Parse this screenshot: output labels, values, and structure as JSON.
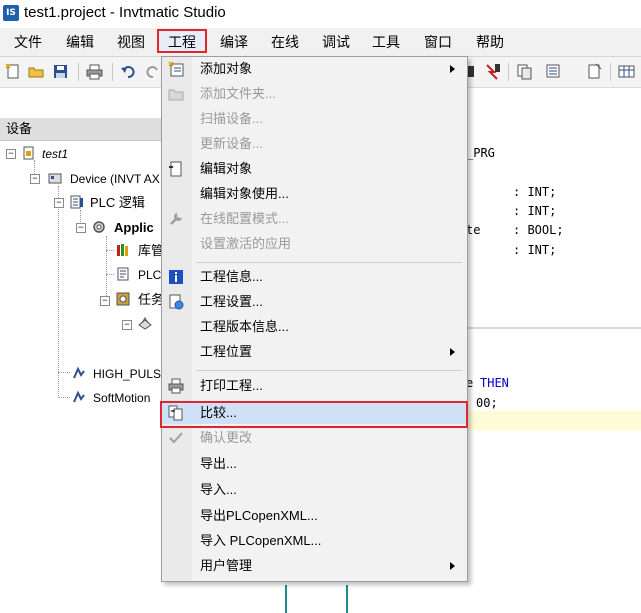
{
  "window": {
    "title": "test1.project - Invtmatic Studio",
    "logo": "IS"
  },
  "menubar": {
    "items": [
      "文件",
      "编辑",
      "视图",
      "工程",
      "编译",
      "在线",
      "调试",
      "工具",
      "窗口",
      "帮助"
    ],
    "active": "工程"
  },
  "device_pane": {
    "header": "设备",
    "tree": {
      "project": "test1",
      "device": "Device (INVT AX",
      "plc_logic": "PLC 逻辑",
      "application": "Applic",
      "library": "库管",
      "plc_prg": "PLC",
      "task": "任务",
      "high_puls": "HIGH_PULS",
      "softmotion": "SoftMotion"
    }
  },
  "editor": {
    "header_fragment": "_PRG",
    "decl_lines": [
      {
        "name": "",
        "type": ": INT;"
      },
      {
        "name": "",
        "type": ": INT;"
      },
      {
        "name": "te",
        "type": ": BOOL;"
      },
      {
        "name": "",
        "type": ": INT;"
      }
    ],
    "code_line1_prefix": "e",
    "code_line1_keyword": "THEN",
    "code_line2": "00;"
  },
  "dropdown": {
    "items": [
      {
        "label": "添加对象",
        "disabled": false,
        "submenu": true,
        "icon": "add-object-icon"
      },
      {
        "label": "添加文件夹...",
        "disabled": true,
        "submenu": false,
        "icon": "folder-icon"
      },
      {
        "label": "扫描设备...",
        "disabled": true,
        "submenu": false,
        "icon": ""
      },
      {
        "label": "更新设备...",
        "disabled": true,
        "submenu": false,
        "icon": ""
      },
      {
        "label": "编辑对象",
        "disabled": false,
        "submenu": false,
        "icon": "edit-object-icon"
      },
      {
        "label": "编辑对象使用...",
        "disabled": false,
        "submenu": false,
        "icon": ""
      },
      {
        "label": "在线配置模式...",
        "disabled": true,
        "submenu": false,
        "icon": "wrench-icon"
      },
      {
        "label": "设置激活的应用",
        "disabled": true,
        "submenu": false,
        "icon": ""
      },
      {
        "label": "工程信息...",
        "disabled": false,
        "submenu": false,
        "icon": "info-icon"
      },
      {
        "label": "工程设置...",
        "disabled": false,
        "submenu": false,
        "icon": "settings-icon"
      },
      {
        "label": "工程版本信息...",
        "disabled": false,
        "submenu": false,
        "icon": ""
      },
      {
        "label": "工程位置",
        "disabled": false,
        "submenu": true,
        "icon": ""
      },
      {
        "label": "打印工程...",
        "disabled": false,
        "submenu": false,
        "icon": "print-icon"
      },
      {
        "label": "比较...",
        "disabled": false,
        "submenu": false,
        "icon": "compare-icon",
        "highlighted": true
      },
      {
        "label": "确认更改",
        "disabled": true,
        "submenu": false,
        "icon": "confirm-icon"
      },
      {
        "label": "导出...",
        "disabled": false,
        "submenu": false,
        "icon": ""
      },
      {
        "label": "导入...",
        "disabled": false,
        "submenu": false,
        "icon": ""
      },
      {
        "label": "导出PLCopenXML...",
        "disabled": false,
        "submenu": false,
        "icon": ""
      },
      {
        "label": "导入 PLCopenXML...",
        "disabled": false,
        "submenu": false,
        "icon": ""
      },
      {
        "label": "用户管理",
        "disabled": false,
        "submenu": true,
        "icon": ""
      }
    ]
  },
  "colors": {
    "highlight_box": "#e0262d",
    "selected_item": "#cfe1f7",
    "keyword": "#0000c8",
    "info_icon": "#1f4fbf"
  }
}
